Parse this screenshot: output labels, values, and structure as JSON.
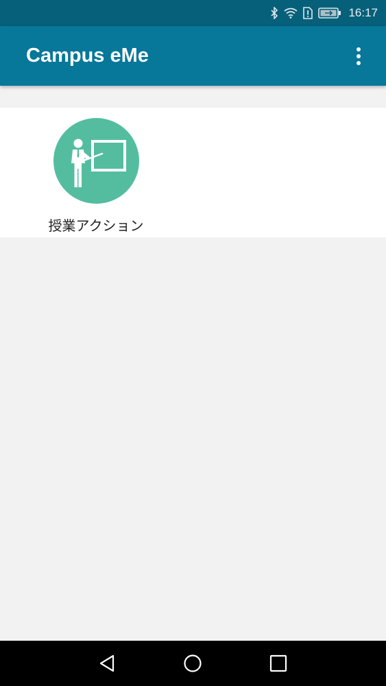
{
  "status_bar": {
    "time": "16:17",
    "icons": [
      "bluetooth-icon",
      "wifi-icon",
      "sim-alert-icon",
      "battery-charging-icon"
    ]
  },
  "app_bar": {
    "title": "Campus eMe",
    "overflow_icon": "more-vert-icon"
  },
  "actions": [
    {
      "label": "授業アクション",
      "icon": "teacher-at-board-icon",
      "icon_bg_color": "#54bda0"
    }
  ],
  "nav_bar": {
    "buttons": [
      "back-icon",
      "home-icon",
      "recents-icon"
    ]
  },
  "colors": {
    "status_bar": "#06607a",
    "app_bar": "#07779a",
    "background": "#f2f2f2",
    "card": "#ffffff"
  }
}
